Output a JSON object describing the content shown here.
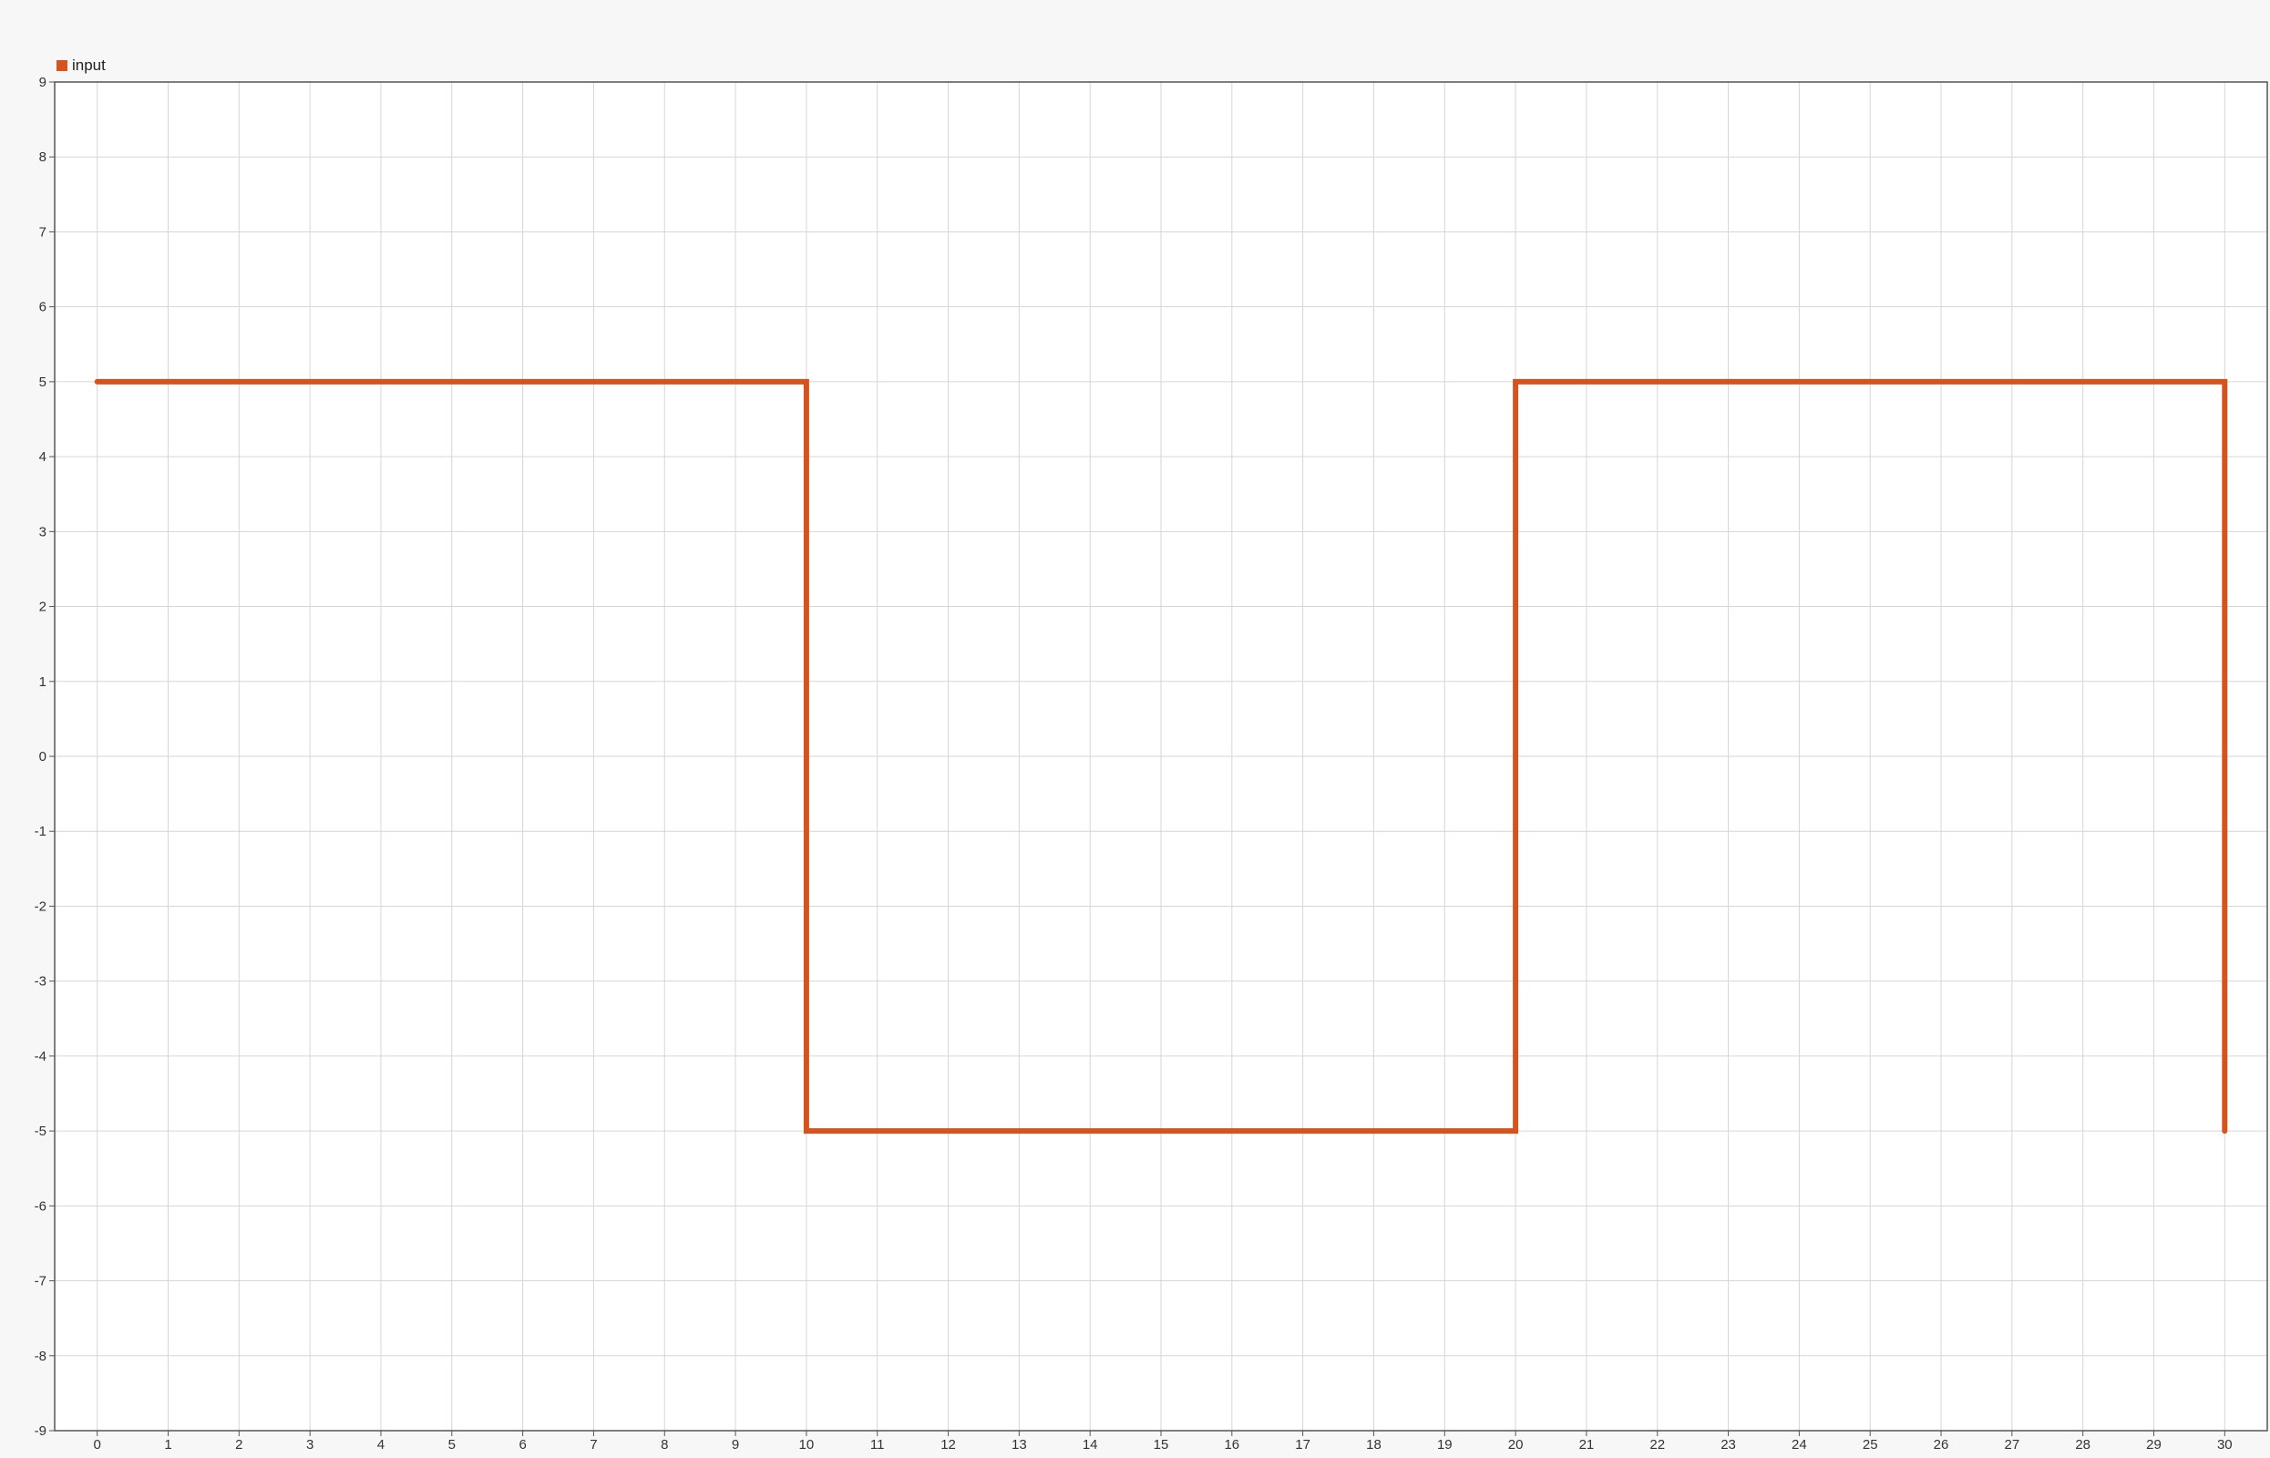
{
  "colors": {
    "background": "#f7f7f7",
    "plot_background": "#ffffff",
    "grid": "#d6d6d6",
    "axis": "#555555",
    "series": "#d4541f"
  },
  "chart_data": {
    "type": "line",
    "title": "",
    "xlabel": "",
    "ylabel": "",
    "xlim": [
      -0.6,
      30.6
    ],
    "ylim": [
      -9,
      9
    ],
    "x_ticks": [
      0,
      1,
      2,
      3,
      4,
      5,
      6,
      7,
      8,
      9,
      10,
      11,
      12,
      13,
      14,
      15,
      16,
      17,
      18,
      19,
      20,
      21,
      22,
      23,
      24,
      25,
      26,
      27,
      28,
      29,
      30
    ],
    "y_ticks": [
      9,
      8,
      7,
      6,
      5,
      4,
      3,
      2,
      1,
      0,
      -1,
      -2,
      -3,
      -4,
      -5,
      -6,
      -7,
      -8,
      -9
    ],
    "grid": true,
    "legend_position": "top-left",
    "series": [
      {
        "name": "input",
        "color": "#d4541f",
        "points": [
          [
            0,
            5
          ],
          [
            10,
            5
          ],
          [
            10,
            -5
          ],
          [
            20,
            -5
          ],
          [
            20,
            5
          ],
          [
            30,
            5
          ],
          [
            30,
            -5
          ]
        ]
      }
    ]
  }
}
